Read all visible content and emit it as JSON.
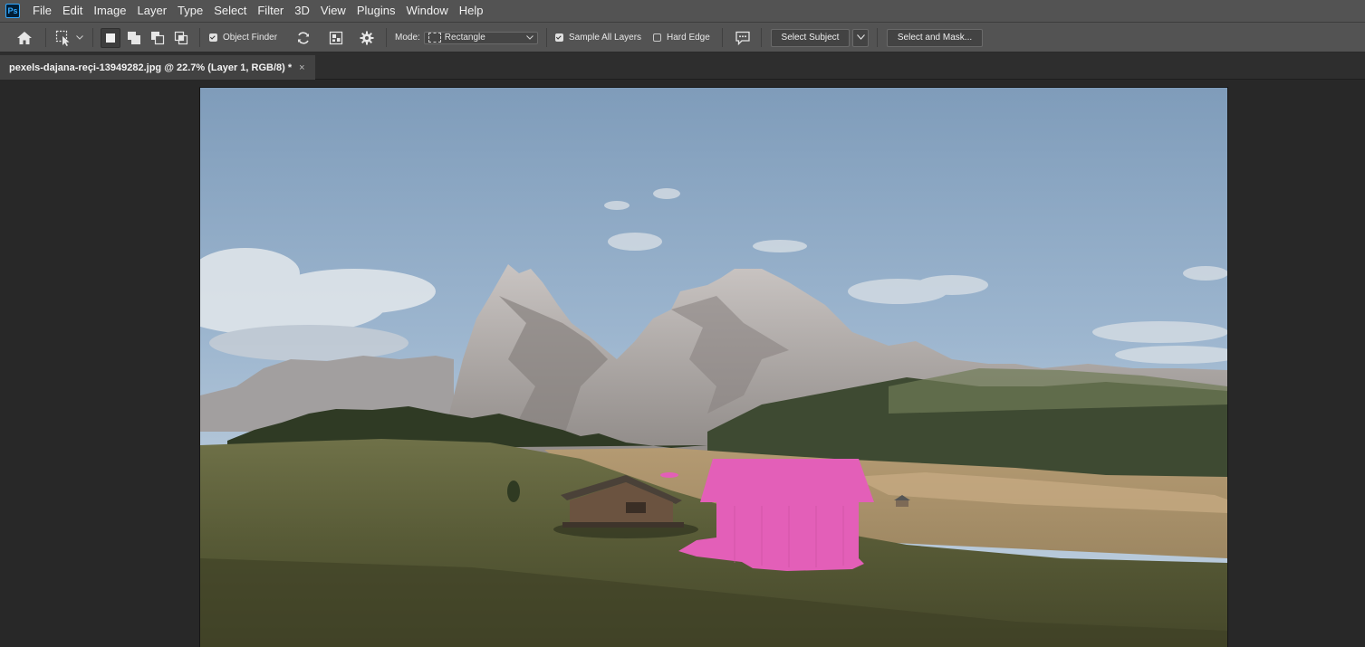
{
  "app": {
    "logo": "Ps"
  },
  "menu": [
    "File",
    "Edit",
    "Image",
    "Layer",
    "Type",
    "Select",
    "Filter",
    "3D",
    "View",
    "Plugins",
    "Window",
    "Help"
  ],
  "options": {
    "object_finder_label": "Object Finder",
    "object_finder_checked": true,
    "mode_label": "Mode:",
    "mode_value": "Rectangle",
    "sample_all_layers_label": "Sample All Layers",
    "sample_all_layers_checked": true,
    "hard_edge_label": "Hard Edge",
    "hard_edge_checked": false,
    "select_subject_label": "Select Subject",
    "select_and_mask_label": "Select and Mask..."
  },
  "document": {
    "tab_title": "pexels-dajana-reçi-13949282.jpg @ 22.7% (Layer 1, RGB/8) *",
    "close_glyph": "×"
  },
  "colors": {
    "chrome": "#535353",
    "workspace": "#282828",
    "selection_overlay": "#e35fb8"
  },
  "icons": [
    "home-icon",
    "object-selection-tool-icon",
    "new-selection-icon",
    "add-to-selection-icon",
    "subtract-from-selection-icon",
    "intersect-selection-icon",
    "refresh-icon",
    "show-all-objects-icon",
    "gear-icon",
    "feedback-icon",
    "chevron-down-icon"
  ]
}
